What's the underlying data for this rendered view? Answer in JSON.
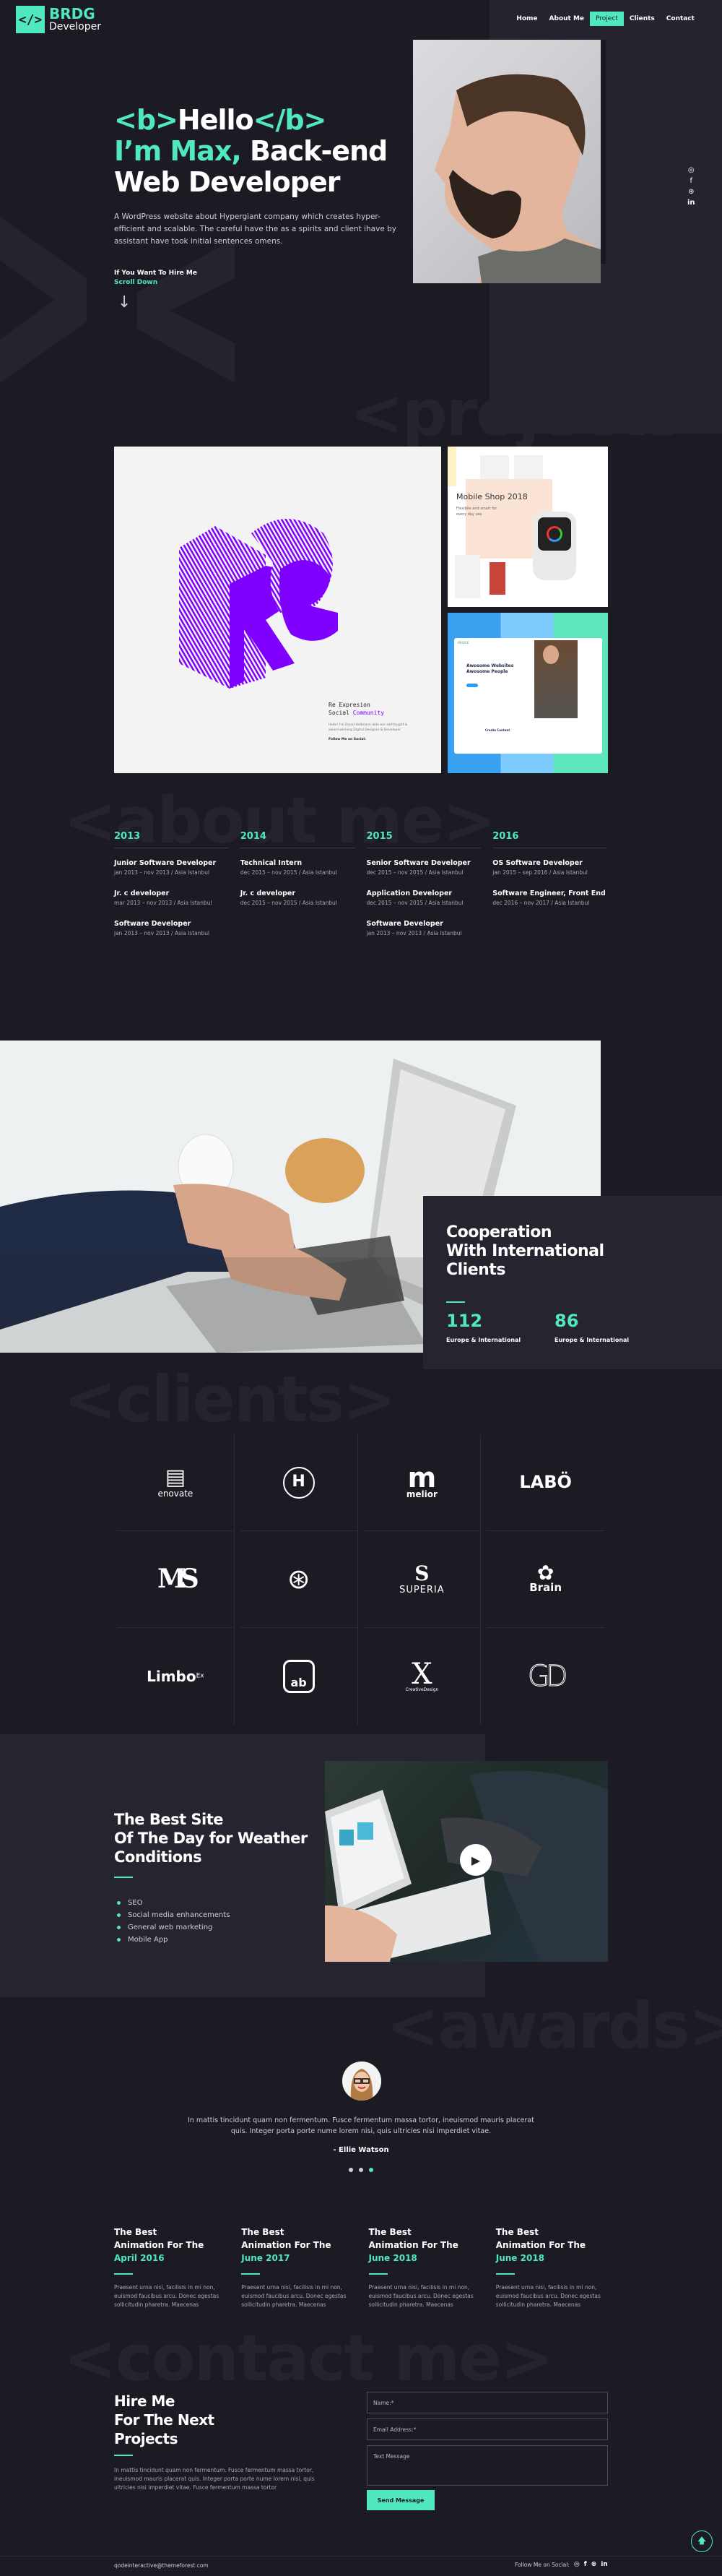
{
  "colors": {
    "accent": "#50e8be",
    "background": "#1c1b24",
    "panel": "#26252f",
    "purple": "#8000ff"
  },
  "header": {
    "logo_glyph": "</>",
    "logo_title": "BRDG",
    "logo_subtitle": "Developer",
    "nav": [
      {
        "label": "Home",
        "active": false
      },
      {
        "label": "About Me",
        "active": false
      },
      {
        "label": "Project",
        "active": true
      },
      {
        "label": "Clients",
        "active": false
      },
      {
        "label": "Contact",
        "active": false
      }
    ]
  },
  "hero": {
    "line1_open": "<b>",
    "line1_word": "Hello",
    "line1_close": "</b>",
    "line2_accent": "I’m Max,",
    "line2_rest": " Back-end",
    "line3": "Web Developer",
    "description": "A WordPress website about Hypergiant company which creates hyper-efficient and scalable. The careful have the as a spirits and client ihave by assistant have took initial sentences omens.",
    "hire_label": "If You Want To Hire Me",
    "scroll_label": "Scroll Down",
    "arrow": "↓",
    "social_icons": [
      "instagram-icon",
      "facebook-icon",
      "dribbble-icon",
      "linkedin-icon"
    ],
    "social_glyphs": [
      "◎",
      "f",
      "⊛",
      "in"
    ]
  },
  "projects": {
    "ghost_title": "<projects>",
    "items": [
      {
        "name": "Re Expresion Social Community",
        "title_line1": "Re Expresion",
        "title_line2_a": "Social ",
        "title_line2_b": "Community",
        "letters": "Re",
        "desc": "Hello! I'm David Hellmann aldo eor self-taught & award winning Digital Designer & Developer",
        "follow": "Follow Me on Social:"
      },
      {
        "name": "Mobile Shop 2018",
        "title": "Mobile Shop 2018",
        "subtitle": "Flexibile and smart for every day use"
      },
      {
        "name": "Bridge Awesome Websites",
        "brand": "BRIDGE",
        "headline1": "Awosome Websites",
        "headline2": "Awosome People",
        "section": "Create Content"
      }
    ]
  },
  "about": {
    "ghost_title": "<about me>",
    "columns": [
      {
        "year": "2013",
        "jobs": [
          {
            "title": "Junior Software Developer",
            "detail": "jan 2013 – nov 2013 / Asia Istanbul"
          },
          {
            "title": "Jr. c developer",
            "detail": "mar 2013 – nov 2013 / Asia Istanbul"
          },
          {
            "title": "Software Developer",
            "detail": "jan 2013 – nov 2013 / Asia Istanbul"
          }
        ]
      },
      {
        "year": "2014",
        "jobs": [
          {
            "title": "Technical Intern",
            "detail": "dec 2015 – nov 2015 / Asia Istanbul"
          },
          {
            "title": "Jr. c developer",
            "detail": "dec 2015 – nov 2015 / Asia Istanbul"
          }
        ]
      },
      {
        "year": "2015",
        "jobs": [
          {
            "title": "Senior Software Developer",
            "detail": "dec 2015 – nov 2015 / Asia Istanbul"
          },
          {
            "title": "Application Developer",
            "detail": "dec 2015 – nov 2015 / Asia Istanbul"
          },
          {
            "title": "Software Developer",
            "detail": "jan 2013 – nov 2013 / Asia Istanbul"
          }
        ]
      },
      {
        "year": "2016",
        "jobs": [
          {
            "title": "OS Software Developer",
            "detail": "jan 2015 – sep 2016 / Asia Istanbul"
          },
          {
            "title": "Software Engineer, Front End",
            "detail": "dec 2016 – nov 2017 / Asia Istanbul"
          }
        ]
      }
    ]
  },
  "cooperation": {
    "title_line1": "Cooperation",
    "title_line2": "With International",
    "title_line3": "Clients",
    "stats": [
      {
        "value": "112",
        "label": "Europe & International"
      },
      {
        "value": "86",
        "label": "Europe & International"
      }
    ]
  },
  "clients": {
    "ghost_title": "<clients>",
    "logos": [
      {
        "name": "enovate",
        "mark": "▤",
        "text": "enovate"
      },
      {
        "name": "H orbit",
        "mark": "H",
        "text": ""
      },
      {
        "name": "melior",
        "mark": "m",
        "text": "melior"
      },
      {
        "name": "LABO",
        "mark": "",
        "text": "LABÖ"
      },
      {
        "name": "MS",
        "mark": "MS",
        "text": ""
      },
      {
        "name": "film snail",
        "mark": "⊛",
        "text": ""
      },
      {
        "name": "SUPERIA",
        "mark": "S",
        "text": "SUPERIA"
      },
      {
        "name": "Brain",
        "mark": "✿",
        "text": "Brain"
      },
      {
        "name": "LimboEx",
        "mark": "",
        "text": "Limbo",
        "sup": "Ex"
      },
      {
        "name": "ab",
        "mark": "ab",
        "text": ""
      },
      {
        "name": "X CreativeDesign",
        "mark": "X",
        "text": "CreativeDesign"
      },
      {
        "name": "GD",
        "mark": "GD",
        "text": ""
      }
    ]
  },
  "weather": {
    "title_line1": "The Best Site",
    "title_line2": "Of The Day for Weather",
    "title_line3": "Conditions",
    "items": [
      "SEO",
      "Social media enhancements",
      "General web marketing",
      "Mobile App"
    ],
    "play_glyph": "▶"
  },
  "awards": {
    "ghost_title": "<awards>",
    "testimonial": {
      "quote": "In mattis tincidunt quam non fermentum. Fusce fermentum massa tortor, ineuismod mauris placerat quis. Integer porta porte nume lorem nisi, quis ultricies nisi imperdiet vitae.",
      "author": "- Ellie Watson",
      "slides": 3,
      "active_slide": 3
    },
    "items": [
      {
        "line1": "The Best",
        "line2": "Animation For The",
        "date": "April 2016",
        "text": "Praesent urna nisi, facilisis in mi non, euismod faucibus arcu. Donec egestas sollicitudin pharetra. Maecenas"
      },
      {
        "line1": "The Best",
        "line2": "Animation For The",
        "date": "June 2017",
        "text": "Praesent urna nisi, facilisis in mi non, euismod faucibus arcu. Donec egestas sollicitudin pharetra. Maecenas"
      },
      {
        "line1": "The Best",
        "line2": "Animation For The",
        "date": "June 2018",
        "text": "Praesent urna nisi, facilisis in mi non, euismod faucibus arcu. Donec egestas sollicitudin pharetra. Maecenas"
      },
      {
        "line1": "The Best",
        "line2": "Animation For The",
        "date": "June 2018",
        "text": "Praesent urna nisi, facilisis in mi non, euismod faucibus arcu. Donec egestas sollicitudin pharetra. Maecenas"
      }
    ]
  },
  "contact": {
    "ghost_title": "<contact me>",
    "title_line1": "Hire Me",
    "title_line2": "For The Next",
    "title_line3": "Projects",
    "text": "In mattis tincidunt quam non fermentum. Fusce fermentum massa tortor, ineuismod mauris placerat quis. Integer porta porte nume lorem nisi, quis ultricies nisi imperdiet vitae. Fusce fermentum massa tortor",
    "name_placeholder": "Name:*",
    "email_placeholder": "Email Address:*",
    "message_placeholder": "Text Message",
    "send_label": "Send Message",
    "to_top_glyph": "🡅"
  },
  "footer": {
    "email": "qodeinteractive@themeforest.com",
    "follow_label": "Follow Me on Social:",
    "social_glyphs": [
      "◎",
      "f",
      "⊛",
      "in"
    ]
  }
}
